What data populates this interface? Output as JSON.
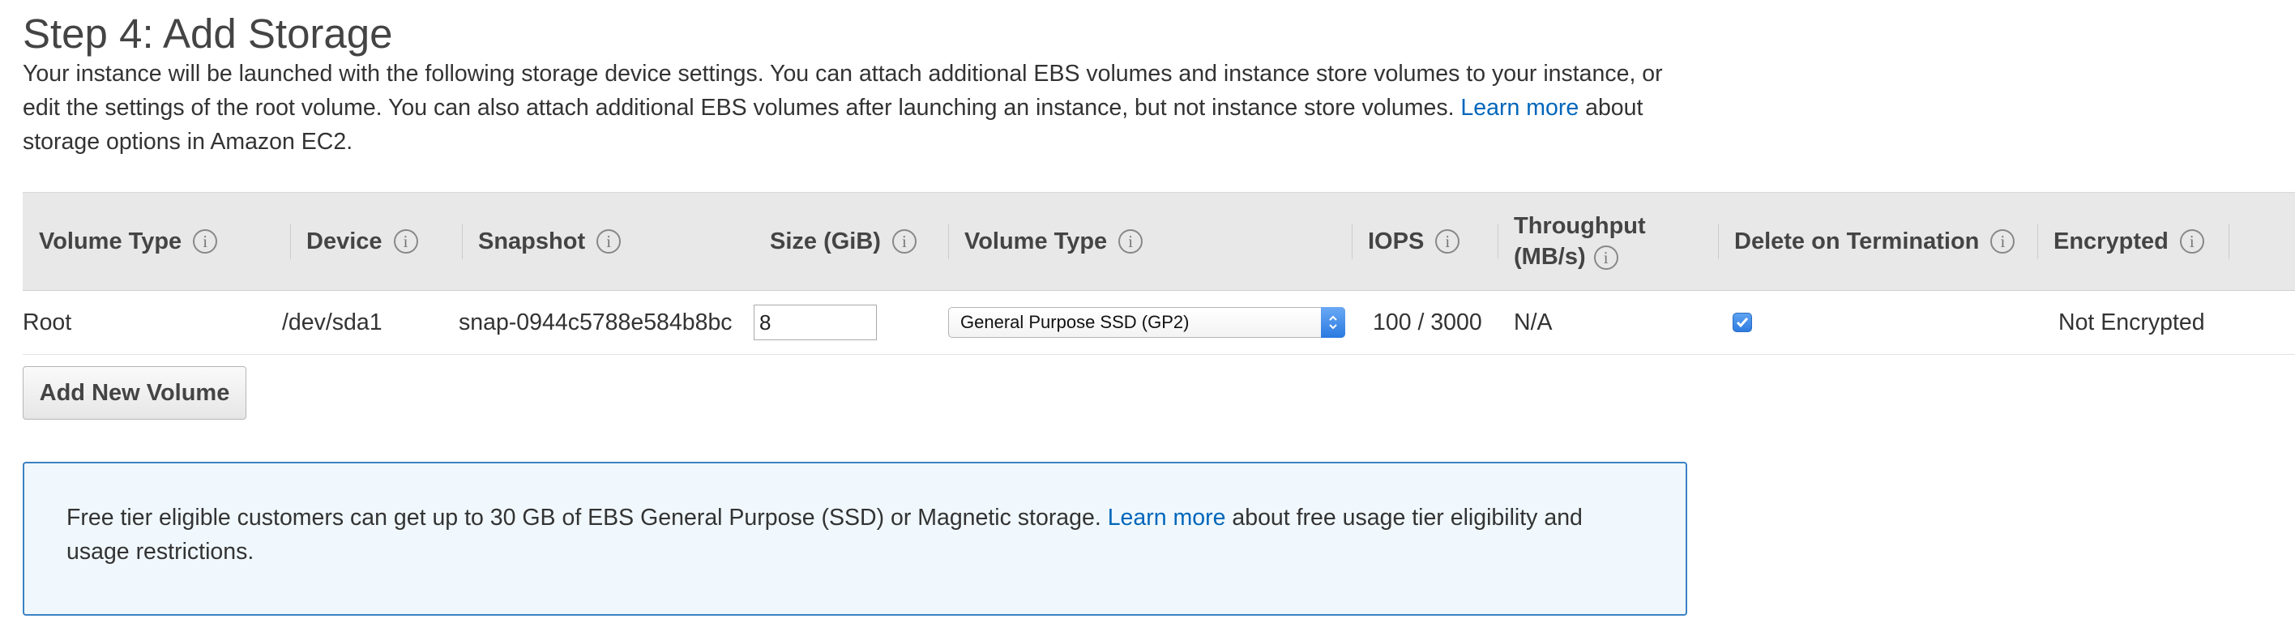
{
  "page": {
    "title": "Step 4: Add Storage",
    "intro_part1": "Your instance will be launched with the following storage device settings. You can attach additional EBS volumes and instance store volumes to your instance, or edit the settings of the root volume. You can also attach additional EBS volumes after launching an instance, but not instance store volumes.",
    "intro_link": "Learn more",
    "intro_part2": "about storage options in Amazon EC2."
  },
  "table": {
    "columns": {
      "volume_type": "Volume Type",
      "device": "Device",
      "snapshot": "Snapshot",
      "size": "Size (GiB)",
      "volume_type_2": "Volume Type",
      "iops": "IOPS",
      "throughput_line1": "Throughput",
      "throughput_line2": "(MB/s)",
      "delete_on_termination": "Delete on Termination",
      "encrypted": "Encrypted"
    },
    "info_glyph": "i",
    "rows": [
      {
        "volume_type": "Root",
        "device": "/dev/sda1",
        "snapshot": "snap-0944c5788e584b8bc",
        "size": "8",
        "ebs_volume_type": "General Purpose SSD (GP2)",
        "iops": "100 / 3000",
        "throughput": "N/A",
        "delete_on_termination": true,
        "encrypted": "Not Encrypted"
      }
    ]
  },
  "buttons": {
    "add_new_volume": "Add New Volume"
  },
  "notice": {
    "text_part1": "Free tier eligible customers can get up to 30 GB of EBS General Purpose (SSD) or Magnetic storage.",
    "link": "Learn more",
    "text_part2": "about free usage tier eligibility and usage restrictions."
  },
  "icons": {
    "info": "info-circle-icon",
    "select_arrows": "updown-chevron-icon",
    "checkbox": "checkmark-icon"
  },
  "colors": {
    "link": "#0066bb",
    "header_bg": "#e8e8e8",
    "notice_border": "#3b82c4",
    "notice_bg": "#f0f8fd",
    "accent_blue": "#2f7ce0"
  }
}
